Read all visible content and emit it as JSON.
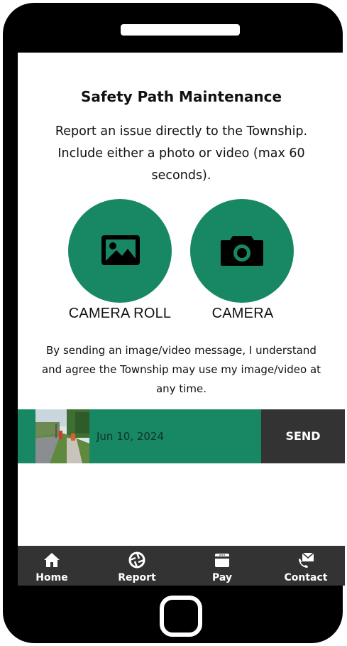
{
  "page": {
    "title": "Safety Path Maintenance",
    "intro": "Report an issue directly to the Township. Include either a photo or video (max 60 seconds).",
    "consent": "By sending an image/video message, I understand and agree the Township may use my image/video at any time."
  },
  "actions": {
    "camera_roll": {
      "label": "CAMERA ROLL",
      "icon": "image-icon"
    },
    "camera": {
      "label": "CAMERA",
      "icon": "camera-icon"
    }
  },
  "attachment": {
    "date": "Jun 10, 2024",
    "send_label": "SEND"
  },
  "tabs": [
    {
      "label": "Home",
      "icon": "house-icon"
    },
    {
      "label": "Report",
      "icon": "aperture-icon"
    },
    {
      "label": "Pay",
      "icon": "card-icon"
    },
    {
      "label": "Contact",
      "icon": "envelope-phone-icon"
    }
  ],
  "colors": {
    "accent": "#178863",
    "dark": "#333333",
    "frame": "#000000"
  }
}
